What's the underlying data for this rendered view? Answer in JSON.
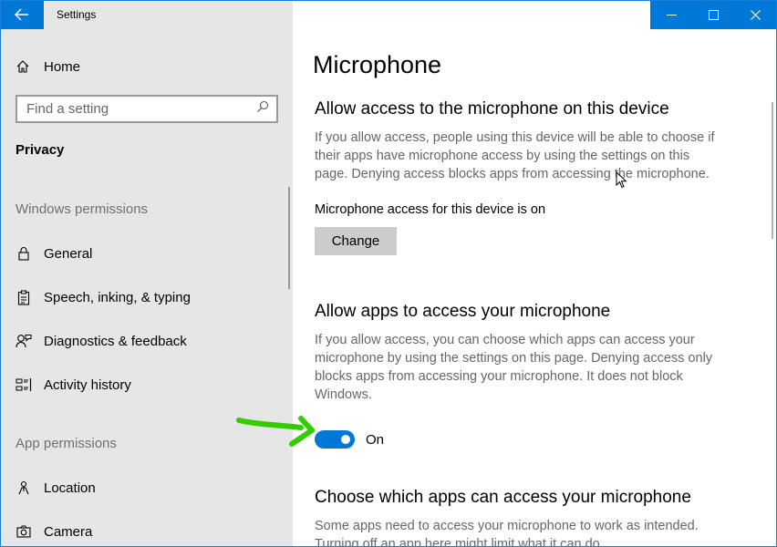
{
  "window": {
    "app_title": "Settings",
    "accent": "#0078d7",
    "controls": [
      "minimize-icon",
      "maximize-icon",
      "close-icon"
    ]
  },
  "sidebar": {
    "home_label": "Home",
    "search": {
      "placeholder": "Find a setting",
      "value": ""
    },
    "section_title": "Privacy",
    "groups": [
      {
        "label": "Windows permissions",
        "items": [
          {
            "label": "General",
            "icon": "lock-icon"
          },
          {
            "label": "Speech, inking, & typing",
            "icon": "clipboard-icon"
          },
          {
            "label": "Diagnostics & feedback",
            "icon": "person-feedback-icon"
          },
          {
            "label": "Activity history",
            "icon": "activity-list-icon"
          }
        ]
      },
      {
        "label": "App permissions",
        "items": [
          {
            "label": "Location",
            "icon": "location-icon"
          },
          {
            "label": "Camera",
            "icon": "camera-icon"
          }
        ]
      }
    ]
  },
  "main": {
    "page_title": "Microphone",
    "device_section": {
      "heading": "Allow access to the microphone on this device",
      "description": "If you allow access, people using this device will be able to choose if their apps have microphone access by using the settings on this page. Denying access blocks apps from accessing the microphone.",
      "status": "Microphone access for this device is on",
      "button_label": "Change"
    },
    "apps_section": {
      "heading": "Allow apps to access your microphone",
      "description": "If you allow access, you can choose which apps can access your microphone by using the settings on this page. Denying access only blocks apps from accessing your microphone. It does not block Windows.",
      "toggle_state": "On",
      "toggle_on": true
    },
    "choose_section": {
      "heading": "Choose which apps can access your microphone",
      "description": "Some apps need to access your microphone to work as intended. Turning off an app here might limit what it can do."
    }
  },
  "annotation": {
    "color": "#33cc00"
  }
}
